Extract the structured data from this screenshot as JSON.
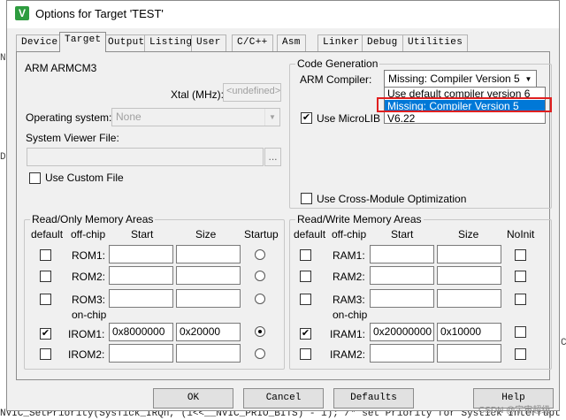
{
  "window": {
    "title": "Options for Target 'TEST'",
    "icon": "keil-uvision-icon"
  },
  "tabs": [
    "Device",
    "Target",
    "Output",
    "Listing",
    "User",
    "C/C++",
    "Asm",
    "Linker",
    "Debug",
    "Utilities"
  ],
  "active_tab": "Target",
  "device": {
    "name": "ARM ARMCM3"
  },
  "xtal": {
    "label": "Xtal (MHz):",
    "value": "<undefined>"
  },
  "os": {
    "label": "Operating system:",
    "value": "None"
  },
  "svf": {
    "label": "System Viewer File:",
    "browse": "...",
    "custom_label": "Use Custom File",
    "custom_checked": false
  },
  "codegen": {
    "title": "Code Generation",
    "compiler_label": "ARM Compiler:",
    "compiler_value": "Missing: Compiler Version 5",
    "options": [
      "Use default compiler version 6",
      "Missing: Compiler Version 5",
      "V6.22"
    ],
    "selected_option": "Missing: Compiler Version 5",
    "microlib_label": "Use MicroLIB",
    "microlib_checked": true,
    "crossmodule_label": "Use Cross-Module Optimization",
    "crossmodule_checked": false
  },
  "rom": {
    "title": "Read/Only Memory Areas",
    "headers": {
      "default": "default",
      "offchip": "off-chip",
      "start": "Start",
      "size": "Size",
      "startup": "Startup"
    },
    "onchip_label": "on-chip",
    "rows": [
      {
        "name": "ROM1:",
        "start": "",
        "size": "",
        "default": false,
        "startup": false
      },
      {
        "name": "ROM2:",
        "start": "",
        "size": "",
        "default": false,
        "startup": false
      },
      {
        "name": "ROM3:",
        "start": "",
        "size": "",
        "default": false,
        "startup": false
      },
      {
        "name": "IROM1:",
        "start": "0x8000000",
        "size": "0x20000",
        "default": true,
        "startup": true
      },
      {
        "name": "IROM2:",
        "start": "",
        "size": "",
        "default": false,
        "startup": false
      }
    ]
  },
  "ram": {
    "title": "Read/Write Memory Areas",
    "headers": {
      "default": "default",
      "offchip": "off-chip",
      "start": "Start",
      "size": "Size",
      "noinit": "NoInit"
    },
    "onchip_label": "on-chip",
    "rows": [
      {
        "name": "RAM1:",
        "start": "",
        "size": "",
        "default": false,
        "noinit": false
      },
      {
        "name": "RAM2:",
        "start": "",
        "size": "",
        "default": false,
        "noinit": false
      },
      {
        "name": "RAM3:",
        "start": "",
        "size": "",
        "default": false,
        "noinit": false
      },
      {
        "name": "IRAM1:",
        "start": "0x20000000",
        "size": "0x10000",
        "default": true,
        "noinit": false
      },
      {
        "name": "IRAM2:",
        "start": "",
        "size": "",
        "default": false,
        "noinit": false
      }
    ]
  },
  "buttons": {
    "ok": "OK",
    "cancel": "Cancel",
    "defaults": "Defaults",
    "help": "Help"
  },
  "background": {
    "bottom_line": "NVIC_SetPriority(SysTick_IRQn, (1<<__NVIC_PRIO_BITS) - 1); /* set Priority for Systick Interrupt */",
    "watermark": "CSDN @宇宙超级"
  },
  "colors": {
    "selection": "#0078d7",
    "highlight_box": "#e02020",
    "dialog_bg": "#f0f0f0"
  }
}
